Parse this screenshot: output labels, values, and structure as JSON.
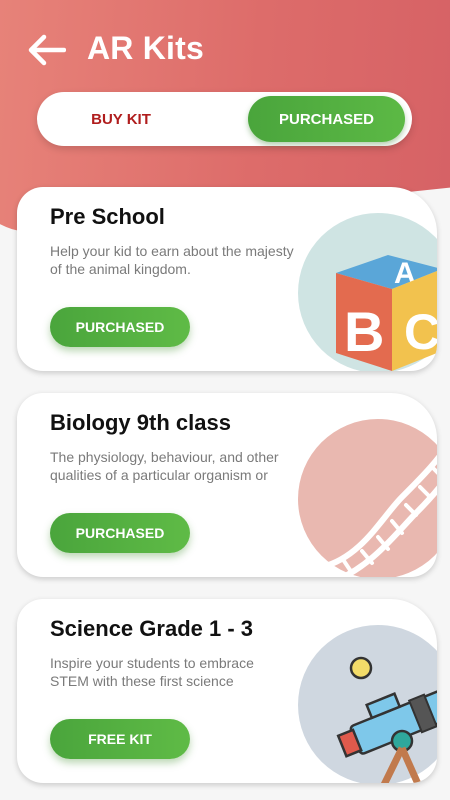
{
  "header": {
    "title": "AR Kits"
  },
  "tabs": {
    "buy_label": "BUY KIT",
    "purchased_label": "PURCHASED"
  },
  "cards": [
    {
      "title": "Pre School",
      "description": "Help your kid to earn about the majesty of the animal kingdom.",
      "button_label": "PURCHASED",
      "art": "abc-blocks-icon"
    },
    {
      "title": "Biology 9th class",
      "description": "The physiology, behaviour, and other qualities of a particular organism or",
      "button_label": "PURCHASED",
      "art": "dna-icon"
    },
    {
      "title": "Science  Grade 1 - 3",
      "description": "Inspire your students to embrace STEM with these first  science",
      "button_label": "FREE KIT",
      "art": "telescope-icon"
    }
  ],
  "colors": {
    "header": "#dd6c6a",
    "accent_green": "#4aa53c",
    "buy_text": "#b01d1d"
  }
}
